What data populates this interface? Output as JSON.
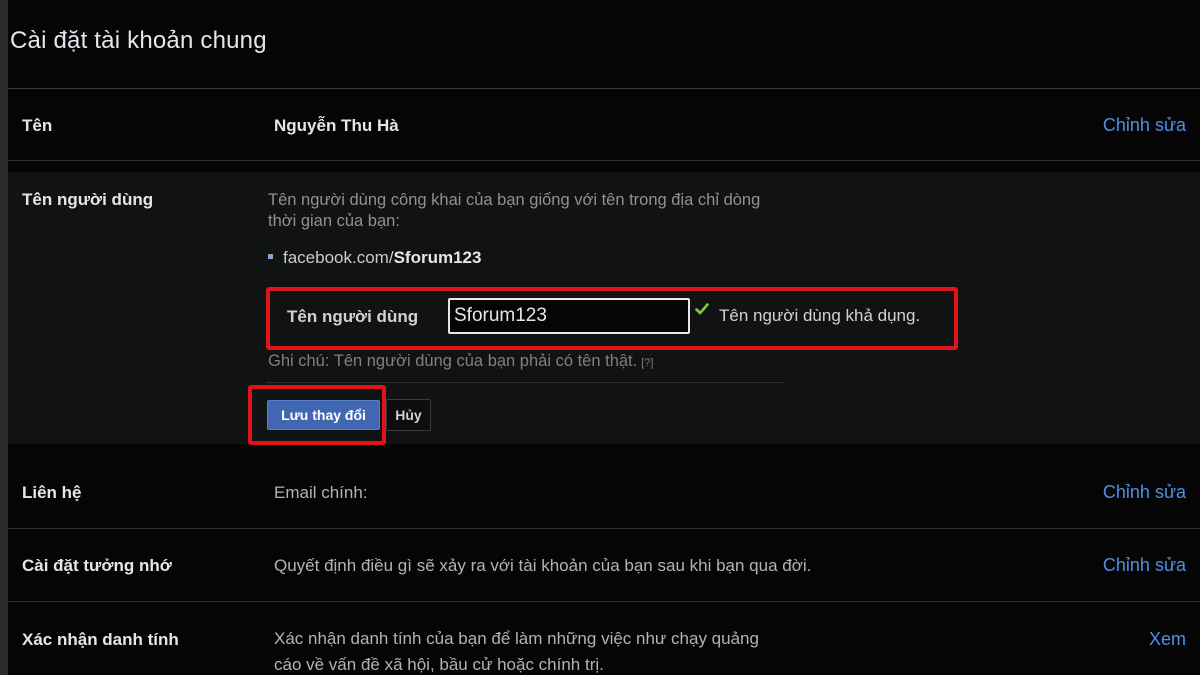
{
  "page_title": "Cài đặt tài khoản chung",
  "rows": {
    "name": {
      "label": "Tên",
      "value": "Nguyễn Thu Hà",
      "action": "Chỉnh sửa"
    },
    "username": {
      "label": "Tên người dùng",
      "description": "Tên người dùng công khai của bạn giống với tên trong địa chỉ dòng thời gian của bạn:",
      "url_prefix": "facebook.com/",
      "url_handle": "Sforum123",
      "field_label": "Tên người dùng",
      "input_value": "Sforum123",
      "availability": "Tên người dùng khả dụng.",
      "note": "Ghi chú: Tên người dùng của bạn phải có tên thật.",
      "help": "[?]",
      "save_label": "Lưu thay đổi",
      "cancel_label": "Hủy"
    },
    "contact": {
      "label": "Liên hệ",
      "value": "Email chính:",
      "action": "Chỉnh sửa"
    },
    "memorial": {
      "label": "Cài đặt tưởng nhớ",
      "value": "Quyết định điều gì sẽ xảy ra với tài khoản của bạn sau khi bạn qua đời.",
      "action": "Chỉnh sửa"
    },
    "identity": {
      "label": "Xác nhận danh tính",
      "value_line1": "Xác nhận danh tính của bạn để làm những việc như chạy quảng",
      "value_line2": "cáo về vấn đề xã hội, bầu cử hoặc chính trị.",
      "action": "Xem"
    }
  },
  "colors": {
    "link": "#4f8fe6",
    "highlight": "#e0121a",
    "primary_button": "#4267b2",
    "check": "#8bc34a"
  },
  "icons": {
    "availability": "check-icon"
  }
}
